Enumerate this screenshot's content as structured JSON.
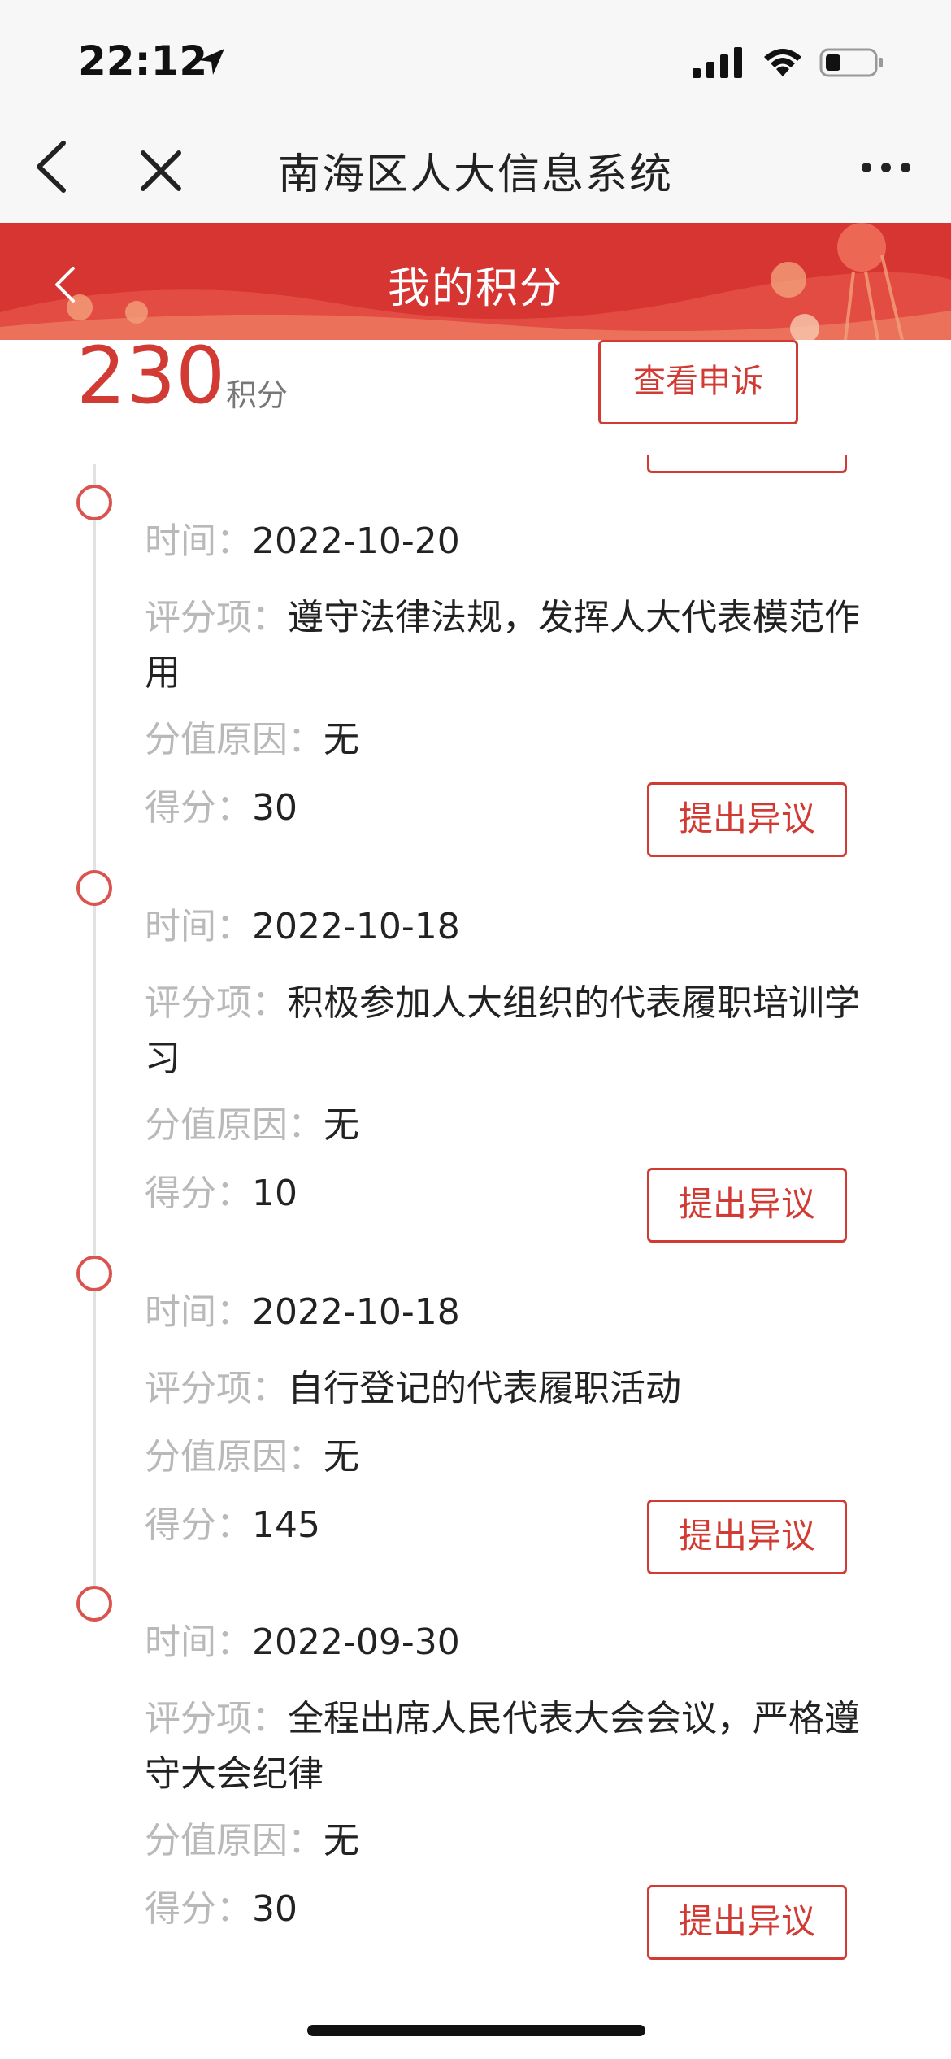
{
  "status_bar": {
    "time": "22:12"
  },
  "nav": {
    "title": "南海区人大信息系统"
  },
  "header": {
    "title": "我的积分"
  },
  "summary": {
    "points": "230",
    "unit": "积分",
    "appeal_button": "查看申诉"
  },
  "labels": {
    "time": "时间：",
    "item": "评分项：",
    "reason": "分值原因：",
    "score": "得分："
  },
  "records": [
    {
      "date": "2022-10-20",
      "item": "遵守法律法规，发挥人大代表模范作用",
      "reason": "无",
      "score": "30",
      "button": "提出异议"
    },
    {
      "date": "2022-10-18",
      "item": "积极参加人大组织的代表履职培训学习",
      "reason": "无",
      "score": "10",
      "button": "提出异议"
    },
    {
      "date": "2022-10-18",
      "item": "自行登记的代表履职活动",
      "reason": "无",
      "score": "145",
      "button": "提出异议"
    },
    {
      "date": "2022-09-30",
      "item": "全程出席人民代表大会会议，严格遵守大会纪律",
      "reason": "无",
      "score": "30",
      "button": "提出异议"
    }
  ],
  "colors": {
    "accent": "#d23a34",
    "header_bg": "#d73532",
    "label_gray": "#b9b9b9"
  }
}
